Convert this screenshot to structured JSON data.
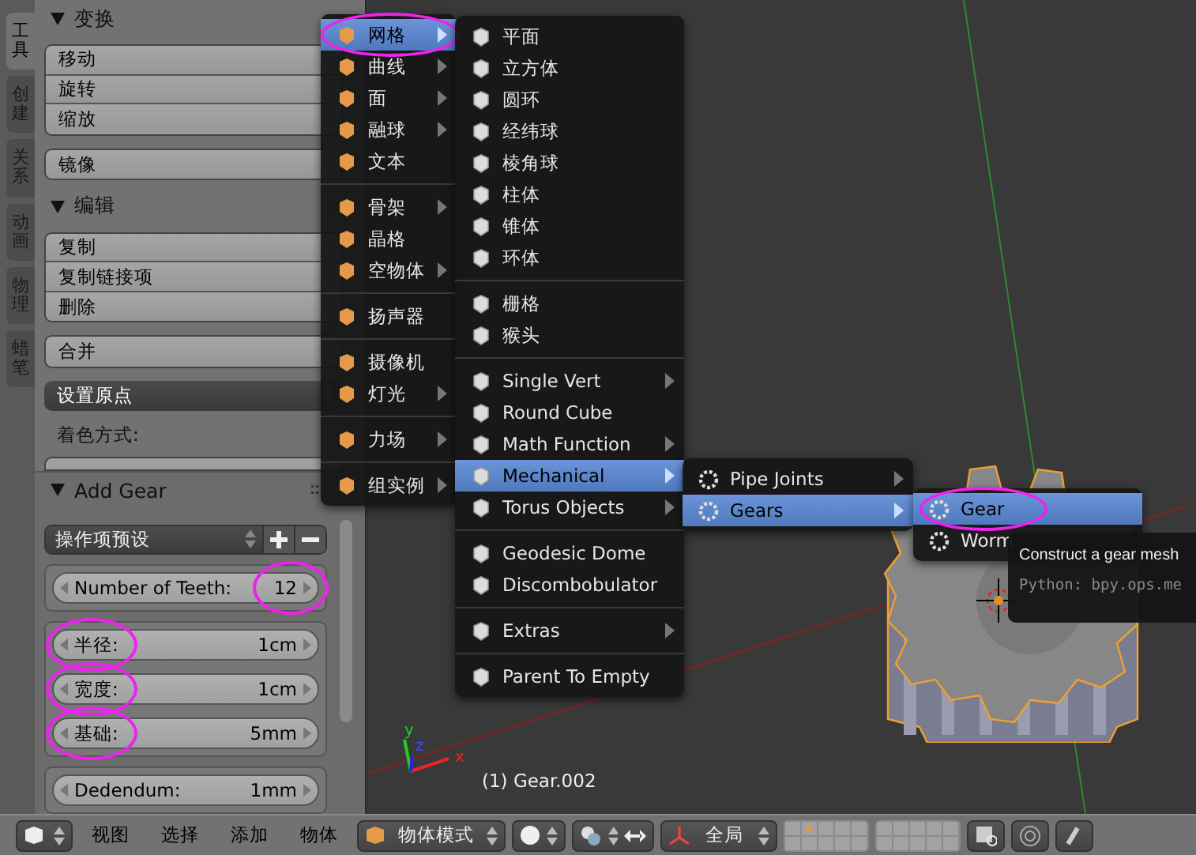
{
  "side_tabs": [
    {
      "label": "工具",
      "selected": true
    },
    {
      "label": "创建",
      "selected": false
    },
    {
      "label": "关系",
      "selected": false
    },
    {
      "label": "动画",
      "selected": false
    },
    {
      "label": "物理",
      "selected": false
    },
    {
      "label": "蜡笔",
      "selected": false
    }
  ],
  "tool_panels": [
    {
      "title": "变换",
      "expanded": true,
      "groups": [
        [
          "移动",
          "旋转",
          "缩放"
        ],
        [
          "镜像"
        ]
      ]
    },
    {
      "title": "编辑",
      "expanded": true,
      "groups": [
        [
          "复制",
          "复制链接项",
          "删除"
        ],
        [
          "合并"
        ]
      ],
      "dropdown": "设置原点",
      "caption": "着色方式:"
    }
  ],
  "operator_panel": {
    "title": "Add Gear",
    "expanded": true,
    "preset": "操作项预设",
    "boxes": [
      [
        {
          "label": "Number of Teeth:",
          "value": "12",
          "label_circled": false,
          "value_circled": true
        }
      ],
      [
        {
          "label": "半径:",
          "value": "1cm",
          "label_circled": true,
          "value_circled": false
        },
        {
          "label": "宽度:",
          "value": "1cm",
          "label_circled": true,
          "value_circled": false
        },
        {
          "label": "基础:",
          "value": "5mm",
          "label_circled": true,
          "value_circled": false
        }
      ],
      [
        {
          "label": "Dedendum:",
          "value": "1mm",
          "label_circled": false,
          "value_circled": false
        }
      ]
    ]
  },
  "menus": [
    {
      "items": [
        {
          "kind": "item",
          "label": "网格",
          "submenu": true,
          "selected": true,
          "circled": true
        },
        {
          "kind": "item",
          "label": "曲线",
          "submenu": true,
          "selected": false,
          "circled": false
        },
        {
          "kind": "item",
          "label": "面",
          "submenu": true,
          "selected": false,
          "circled": false
        },
        {
          "kind": "item",
          "label": "融球",
          "submenu": true,
          "selected": false,
          "circled": false
        },
        {
          "kind": "item",
          "label": "文本",
          "submenu": false,
          "selected": false,
          "circled": false
        },
        {
          "kind": "separator"
        },
        {
          "kind": "item",
          "label": "骨架",
          "submenu": true,
          "selected": false,
          "circled": false
        },
        {
          "kind": "item",
          "label": "晶格",
          "submenu": false,
          "selected": false,
          "circled": false
        },
        {
          "kind": "item",
          "label": "空物体",
          "submenu": true,
          "selected": false,
          "circled": false
        },
        {
          "kind": "separator"
        },
        {
          "kind": "item",
          "label": "扬声器",
          "submenu": false,
          "selected": false,
          "circled": false
        },
        {
          "kind": "separator"
        },
        {
          "kind": "item",
          "label": "摄像机",
          "submenu": false,
          "selected": false,
          "circled": false
        },
        {
          "kind": "item",
          "label": "灯光",
          "submenu": true,
          "selected": false,
          "circled": false
        },
        {
          "kind": "separator"
        },
        {
          "kind": "item",
          "label": "力场",
          "submenu": true,
          "selected": false,
          "circled": false
        },
        {
          "kind": "separator"
        },
        {
          "kind": "item",
          "label": "组实例",
          "submenu": true,
          "selected": false,
          "circled": false
        }
      ]
    },
    {
      "items": [
        {
          "kind": "item",
          "label": "平面",
          "submenu": false,
          "selected": false
        },
        {
          "kind": "item",
          "label": "立方体",
          "submenu": false,
          "selected": false
        },
        {
          "kind": "item",
          "label": "圆环",
          "submenu": false,
          "selected": false
        },
        {
          "kind": "item",
          "label": "经纬球",
          "submenu": false,
          "selected": false
        },
        {
          "kind": "item",
          "label": "棱角球",
          "submenu": false,
          "selected": false
        },
        {
          "kind": "item",
          "label": "柱体",
          "submenu": false,
          "selected": false
        },
        {
          "kind": "item",
          "label": "锥体",
          "submenu": false,
          "selected": false
        },
        {
          "kind": "item",
          "label": "环体",
          "submenu": false,
          "selected": false
        },
        {
          "kind": "separator"
        },
        {
          "kind": "item",
          "label": "栅格",
          "submenu": false,
          "selected": false
        },
        {
          "kind": "item",
          "label": "猴头",
          "submenu": false,
          "selected": false
        },
        {
          "kind": "separator"
        },
        {
          "kind": "item",
          "label": "Single Vert",
          "submenu": true,
          "selected": false
        },
        {
          "kind": "item",
          "label": "Round Cube",
          "submenu": false,
          "selected": false
        },
        {
          "kind": "item",
          "label": "Math Function",
          "submenu": true,
          "selected": false
        },
        {
          "kind": "item",
          "label": "Mechanical",
          "submenu": true,
          "selected": true
        },
        {
          "kind": "item",
          "label": "Torus Objects",
          "submenu": true,
          "selected": false
        },
        {
          "kind": "separator"
        },
        {
          "kind": "item",
          "label": "Geodesic Dome",
          "submenu": false,
          "selected": false
        },
        {
          "kind": "item",
          "label": "Discombobulator",
          "submenu": false,
          "selected": false
        },
        {
          "kind": "separator"
        },
        {
          "kind": "item",
          "label": "Extras",
          "submenu": true,
          "selected": false
        },
        {
          "kind": "separator"
        },
        {
          "kind": "item",
          "label": "Parent To Empty",
          "submenu": false,
          "selected": false
        }
      ]
    },
    {
      "items": [
        {
          "kind": "item",
          "label": "Pipe Joints",
          "submenu": true,
          "selected": false
        },
        {
          "kind": "item",
          "label": "Gears",
          "submenu": true,
          "selected": true
        }
      ]
    },
    {
      "items": [
        {
          "kind": "item",
          "label": "Gear",
          "submenu": false,
          "selected": true,
          "circled": true
        },
        {
          "kind": "item",
          "label": "Worm",
          "submenu": false,
          "selected": false,
          "circled": false
        }
      ]
    }
  ],
  "tooltip": {
    "title": "Construct a gear mesh",
    "python": "Python: bpy.ops.me"
  },
  "viewport": {
    "object_label": "(1) Gear.002",
    "axis_labels": [
      "y",
      "z",
      "x"
    ]
  },
  "header": {
    "menus": [
      "视图",
      "选择",
      "添加",
      "物体"
    ],
    "mode": "物体模式",
    "orientation": "全局"
  }
}
